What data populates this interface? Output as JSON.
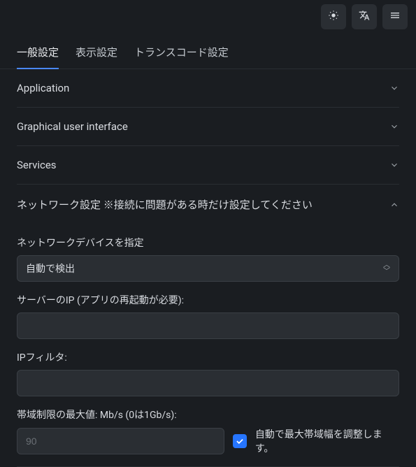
{
  "topbar": {
    "theme_icon": "brightness",
    "lang_icon": "translate",
    "menu_icon": "hamburger"
  },
  "tabs": [
    {
      "label": "一般設定",
      "active": true
    },
    {
      "label": "表示設定",
      "active": false
    },
    {
      "label": "トランスコード設定",
      "active": false
    }
  ],
  "sections": {
    "application": {
      "title": "Application",
      "expanded": false
    },
    "gui": {
      "title": "Graphical user interface",
      "expanded": false
    },
    "services": {
      "title": "Services",
      "expanded": false
    },
    "network": {
      "title": "ネットワーク設定 ※接続に問題がある時だけ設定してください",
      "expanded": true,
      "device_label": "ネットワークデバイスを指定",
      "device_value": "自動で検出",
      "server_ip_label": "サーバーのIP (アプリの再起動が必要):",
      "server_ip_value": "",
      "ip_filter_label": "IPフィルタ:",
      "ip_filter_value": "",
      "bandwidth_label": "帯域制限の最大値: Mb/s (0は1Gb/s):",
      "bandwidth_value": "90",
      "auto_bandwidth_checked": true,
      "auto_bandwidth_label": "自動で最大帯域幅を調整します。"
    }
  }
}
